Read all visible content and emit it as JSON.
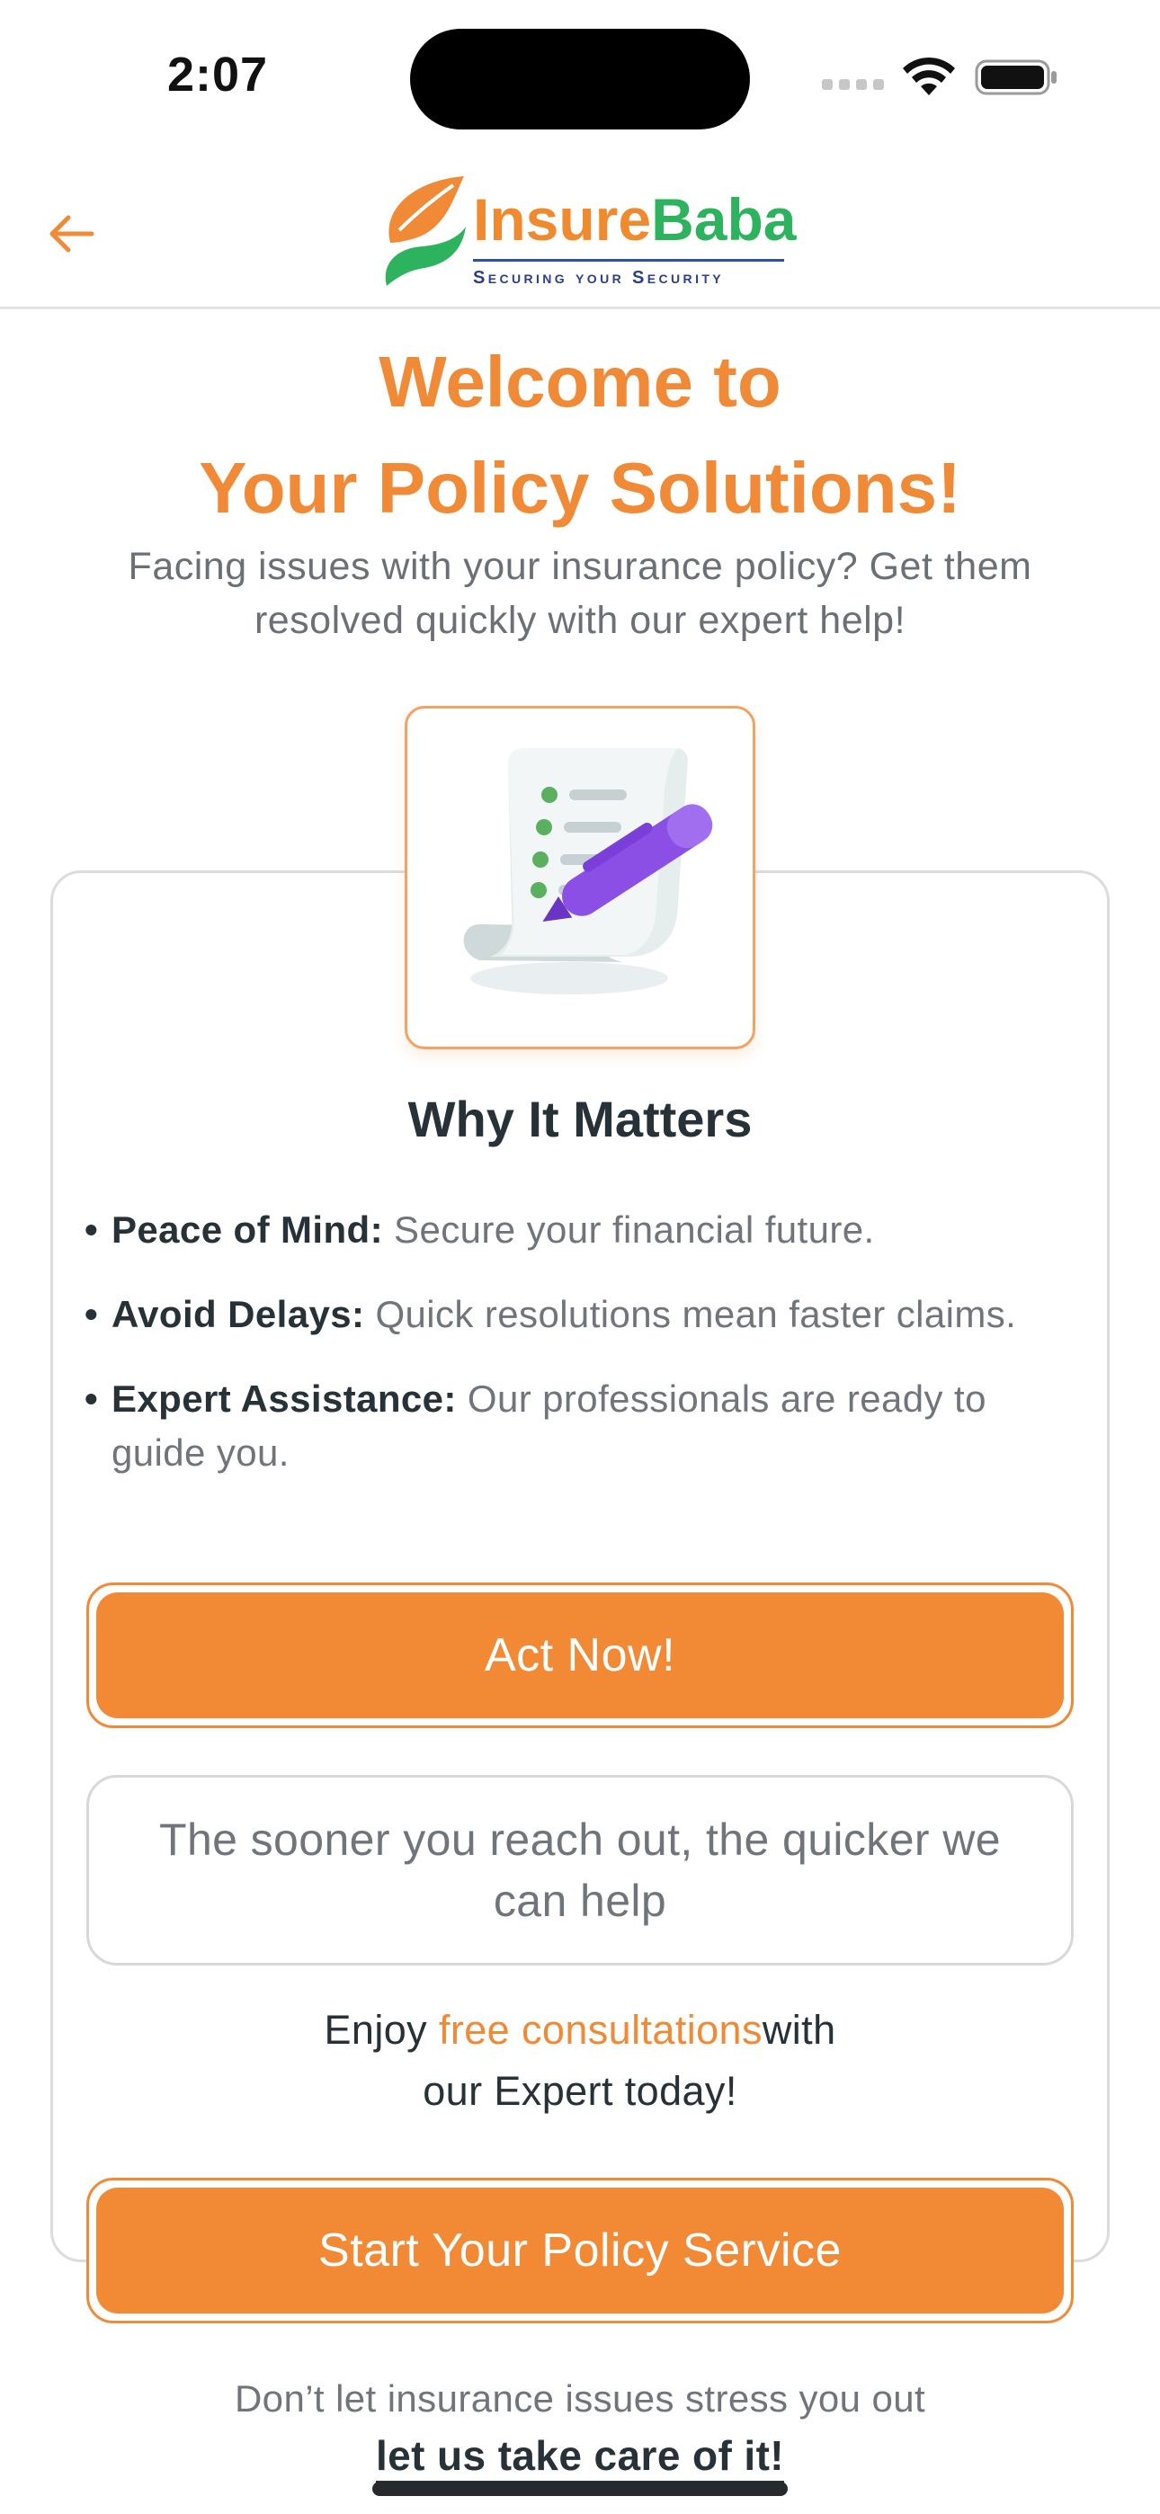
{
  "status_bar": {
    "time": "2:07",
    "icons": [
      "signal-icon",
      "wifi-icon",
      "battery-icon"
    ]
  },
  "header": {
    "back_icon": "arrow-left-icon",
    "logo": {
      "word_part1": "Insure",
      "word_part2": "Baba",
      "tagline": "Securing your Security"
    }
  },
  "hero": {
    "title_line1": "Welcome to",
    "title_line2": "Your Policy Solutions!",
    "subtitle": "Facing issues with your insurance policy? Get them resolved quickly with our expert help!"
  },
  "card": {
    "illustration": "document-with-pen-icon",
    "section_title": "Why It Matters",
    "benefits": [
      {
        "label": "Peace of Mind:",
        "text": " Secure your financial future."
      },
      {
        "label": "Avoid Delays:",
        "text": " Quick resolutions mean faster claims."
      },
      {
        "label": "Expert Assistance:",
        "text": " Our professionals are ready to guide you."
      }
    ],
    "bullet": "•",
    "act_now_label": "Act Now!",
    "callout": "The sooner you reach out, the quicker we can help",
    "consult_prefix": "Enjoy ",
    "consult_highlight": "free consultations",
    "consult_suffix": "with",
    "consult_line2": "our Expert today!"
  },
  "start_service_label": "Start Your Policy Service",
  "footer": {
    "note": "Don’t let insurance issues stress you out",
    "cta": "let us take care of it!"
  },
  "colors": {
    "accent": "#f28a35",
    "brand_green": "#2db35d",
    "brand_blue": "#2c3f8d",
    "text_dark": "#263138",
    "text_muted": "#6f757b"
  }
}
